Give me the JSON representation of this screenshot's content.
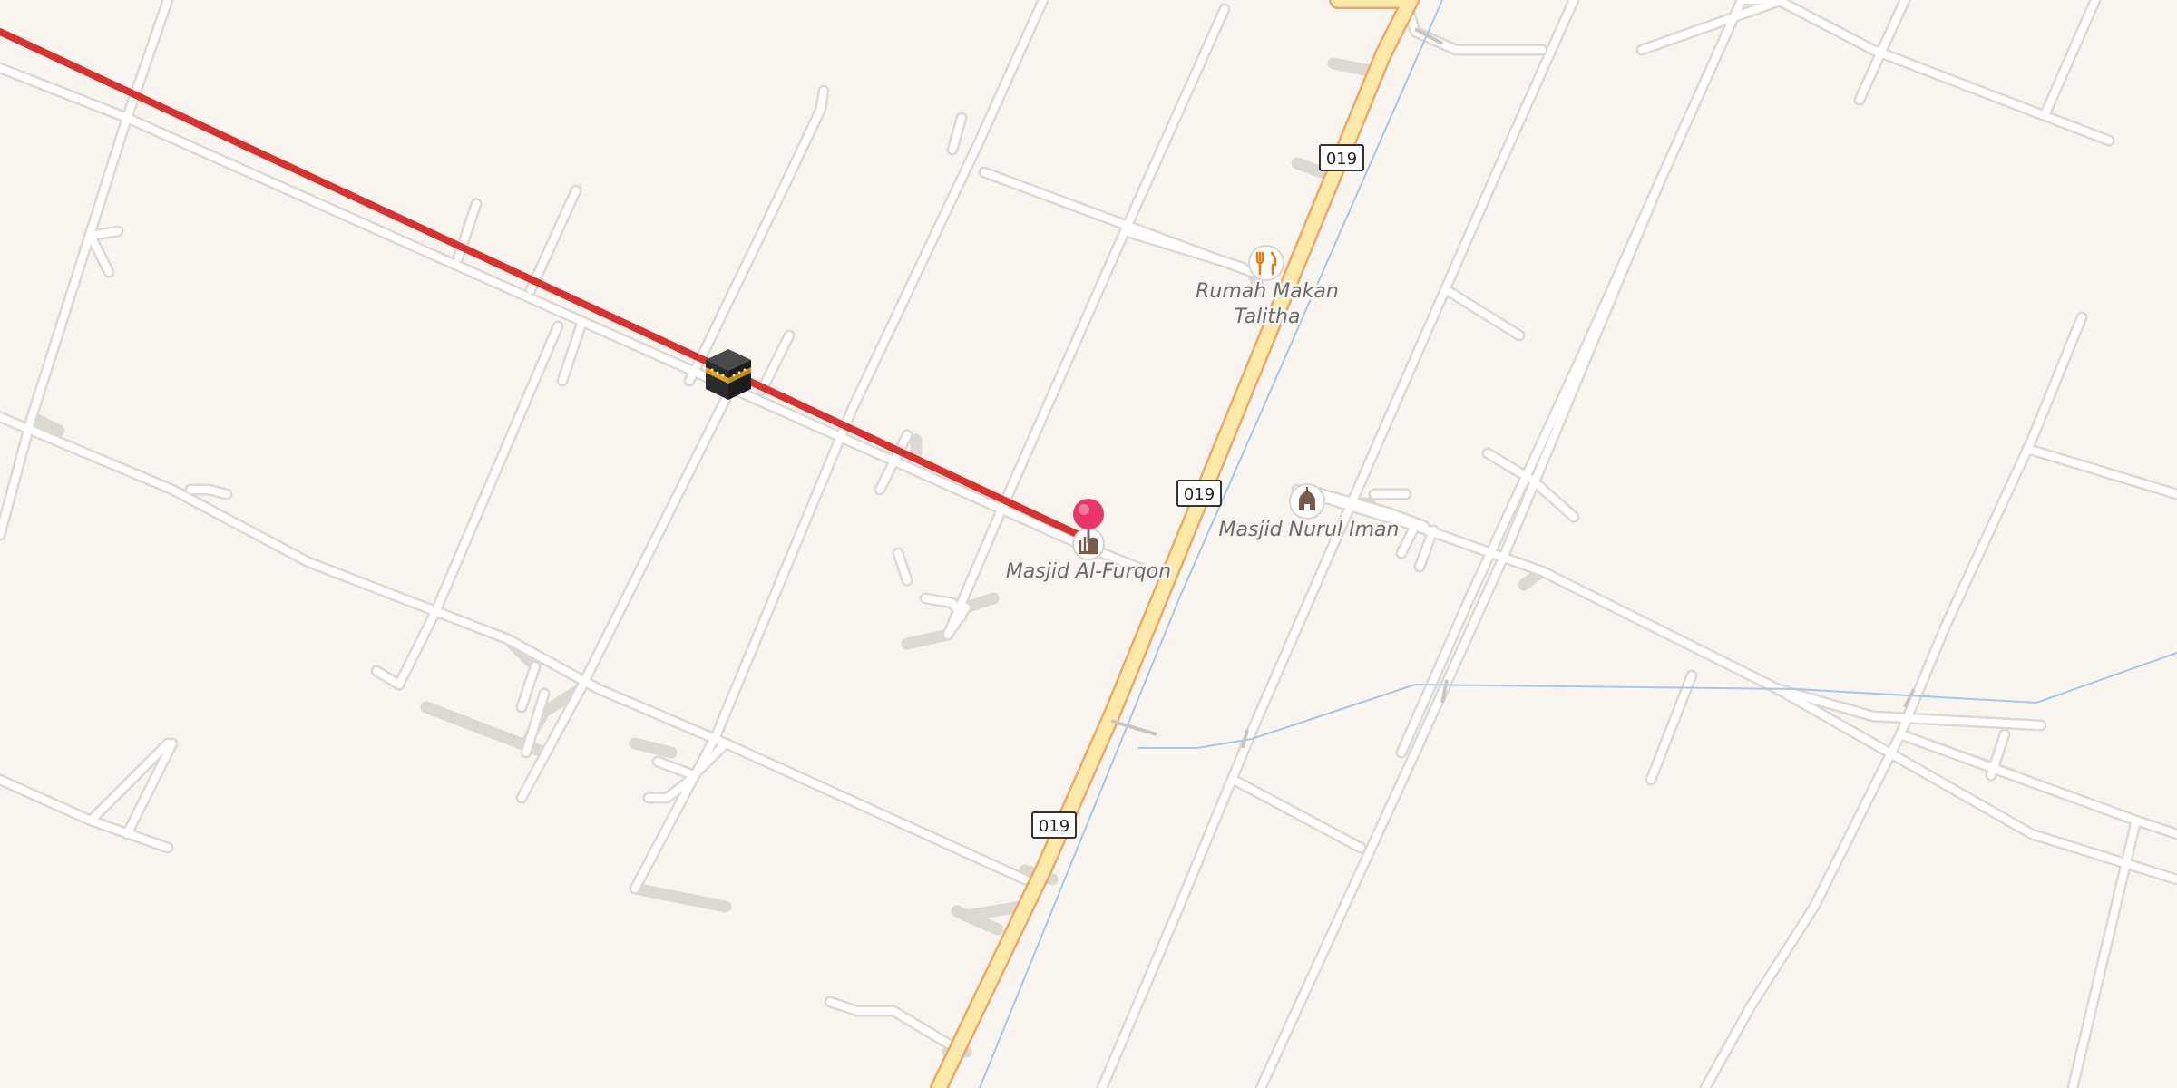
{
  "map": {
    "route_shields": [
      {
        "id": "shield-1",
        "label": "019"
      },
      {
        "id": "shield-2",
        "label": "019"
      },
      {
        "id": "shield-3",
        "label": "019"
      }
    ],
    "pois": [
      {
        "id": "poi-restaurant",
        "icon": "restaurant-icon",
        "label_line1": "Rumah Makan",
        "label_line2": "Talitha"
      },
      {
        "id": "poi-mosque-nurul",
        "icon": "mosque-icon",
        "label_line1": "Masjid Nurul Iman"
      },
      {
        "id": "poi-mosque-furqon",
        "icon": "mosque-icon",
        "label_line1": "Masjid Al-Furqon"
      }
    ],
    "markers": {
      "kaaba": "kaaba-icon",
      "location_pin": "location-pin-icon"
    },
    "colors": {
      "background": "#f8f5f0",
      "qibla_line": "#d93030",
      "main_road": "#fde9a8",
      "main_road_casing": "#e9a86a",
      "pin": "#e8366a",
      "water": "#a9c6e6"
    }
  }
}
